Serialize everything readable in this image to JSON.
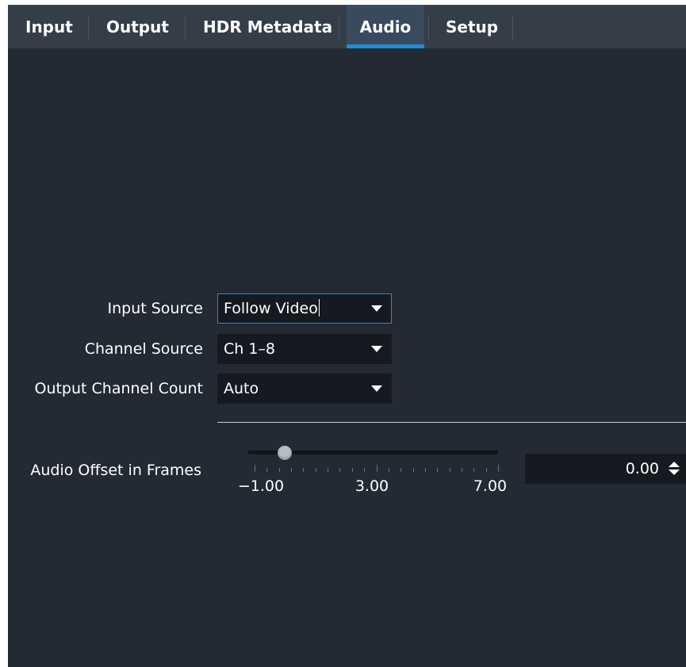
{
  "tabs": [
    {
      "label": "Input",
      "active": false
    },
    {
      "label": "Output",
      "active": false
    },
    {
      "label": "HDR Metadata",
      "active": false
    },
    {
      "label": "Audio",
      "active": true
    },
    {
      "label": "Setup",
      "active": false
    }
  ],
  "audio": {
    "input_source": {
      "label": "Input Source",
      "value": "Follow Video"
    },
    "channel_source": {
      "label": "Channel Source",
      "value": "Ch 1–8"
    },
    "output_channel_count": {
      "label": "Output Channel Count",
      "value": "Auto"
    },
    "offset": {
      "label": "Audio Offset in Frames",
      "value": "0.00",
      "slider_min": -1,
      "slider_max": 7,
      "slider_value": 0,
      "tick_labels": [
        "−1.00",
        "3.00",
        "7.00"
      ]
    }
  },
  "colors": {
    "accent": "#1d8fd6",
    "background": "#232a33",
    "tabbar": "#353d49",
    "field": "#161a20"
  },
  "icons": {
    "dropdown": "triangle-down-icon",
    "spinner": "up-down-arrows-icon"
  }
}
